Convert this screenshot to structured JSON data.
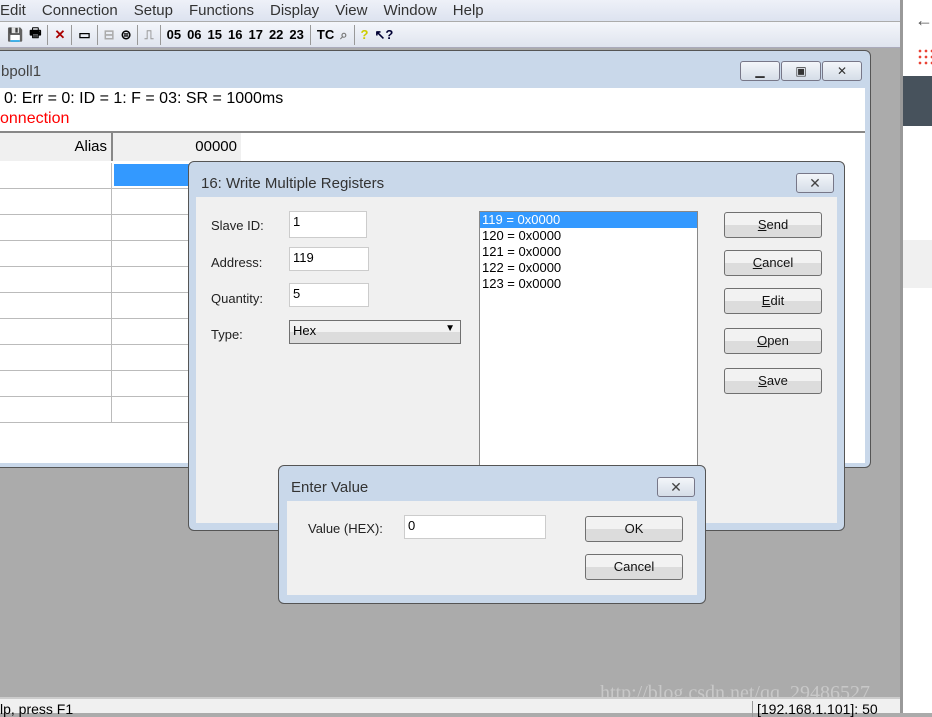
{
  "menu": [
    "Edit",
    "Connection",
    "Setup",
    "Functions",
    "Display",
    "View",
    "Window",
    "Help"
  ],
  "toolbar": {
    "icons": [
      "save-icon",
      "print-icon",
      "disconnect-icon",
      "window-icon",
      "connect-icon",
      "printer-icon",
      "pulse-icon"
    ],
    "function_codes": [
      "05",
      "06",
      "15",
      "16",
      "17",
      "22",
      "23"
    ],
    "tc": "TC",
    "icons2": [
      "monitor-icon",
      "help-icon",
      "context-help-icon"
    ]
  },
  "child": {
    "title": "bpoll1",
    "info": "0: Err = 0: ID = 1: F = 03: SR = 1000ms",
    "status": "onnection",
    "grid": {
      "alias_header": "Alias",
      "col_header": "00000",
      "rows": 10
    },
    "highlight_color": "#3399ff"
  },
  "write_dialog": {
    "title": "16: Write Multiple Registers",
    "slave_id_label": "Slave ID:",
    "slave_id": "1",
    "address_label": "Address:",
    "address": "119",
    "quantity_label": "Quantity:",
    "quantity": "5",
    "type_label": "Type:",
    "type": "Hex",
    "registers": [
      "119 = 0x0000",
      "120 = 0x0000",
      "121 = 0x0000",
      "122 = 0x0000",
      "123 = 0x0000"
    ],
    "buttons": {
      "send": "Send",
      "cancel": "Cancel",
      "edit": "Edit",
      "open": "Open",
      "save": "Save"
    }
  },
  "enter_dialog": {
    "title": "Enter Value",
    "value_label": "Value (HEX):",
    "value": "0",
    "ok": "OK",
    "cancel": "Cancel"
  },
  "statusbar": {
    "left": "lp, press F1",
    "right": "[192.168.1.101]: 50"
  },
  "watermark": "http://blog.csdn.net/qq_29486527"
}
